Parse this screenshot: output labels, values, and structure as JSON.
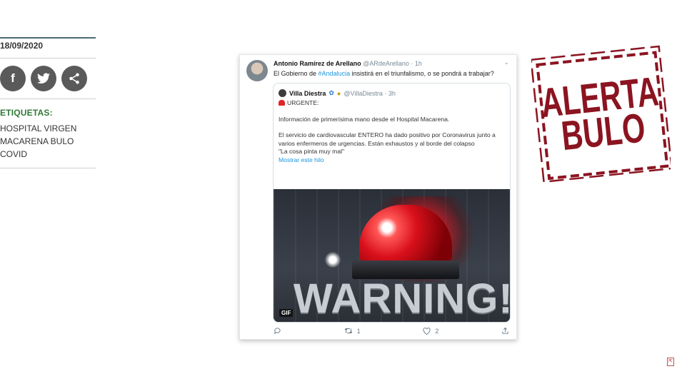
{
  "date": "18/09/2020",
  "share": {
    "facebook": "f",
    "twitter": "t",
    "share": "share"
  },
  "tags": {
    "label": "ETIQUETAS:",
    "items": [
      "HOSPITAL VIRGEN",
      "MACARENA BULO",
      "COVID"
    ]
  },
  "tweet": {
    "author": "Antonio Ramírez de Arellano",
    "handle": "@ARdeArellano · 1h",
    "text_before": "El Gobierno de ",
    "hashtag": "#Andalucia",
    "text_after": " insistirá en el triunfalismo, o se pondrá a trabajar?",
    "quoted": {
      "author": "Villa Diestra",
      "handle": "@VillaDiestra · 3h",
      "line1": "URGENTE:",
      "line2": "Información de primerísima mano desde el Hospital Macarena.",
      "line3": "El servicio de cardiovascular ENTERO ha dado positivo por Coronavirus junto a varios enfermeros de urgencias. Están exhaustos y al borde del colapso",
      "line4": "\"La cosa pinta muy mal\"",
      "show_thread": "Mostrar este hilo",
      "media_text": "WARNING!",
      "media_badge": "GIF"
    },
    "actions": {
      "reply": "",
      "retweet": "1",
      "like": "2",
      "share": ""
    }
  },
  "stamp": {
    "line1": "ALERTA",
    "line2": "BULO",
    "color": "#8b1420"
  }
}
